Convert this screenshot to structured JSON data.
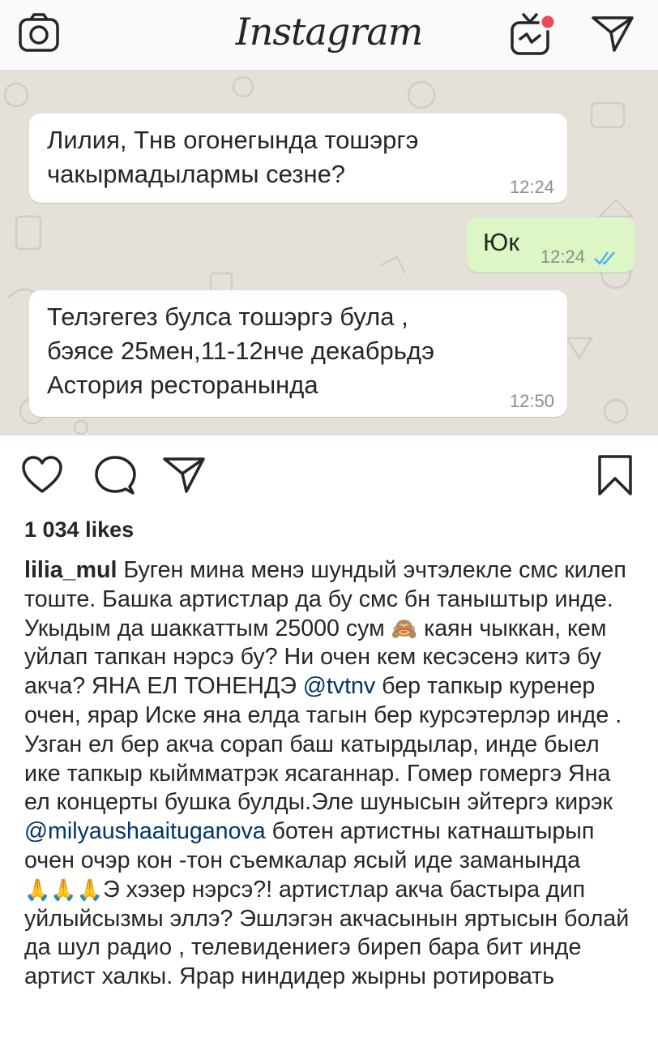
{
  "app": {
    "logo_text": "Instagram",
    "icons": [
      "camera-icon",
      "igtv-icon",
      "direct-message-icon"
    ]
  },
  "chat": {
    "messages": [
      {
        "direction": "incoming",
        "text_lines": [
          "Лилия, Тнв огонегында тошэргэ",
          "чакырмадылармы сезне?"
        ],
        "time": "12:24"
      },
      {
        "direction": "outgoing",
        "text_lines": [
          "Юк"
        ],
        "time": "12:24",
        "status": "read"
      },
      {
        "direction": "incoming",
        "text_lines": [
          "Телэгегез булса тошэргэ була ,",
          "бэясе 25мен,11-12нче декабрьдэ",
          "Астория ресторанында"
        ],
        "time": "12:50"
      }
    ]
  },
  "post": {
    "likes": "1 034 likes",
    "username": "lilia_mul",
    "caption_parts": {
      "p1": "Буген мина менэ шундый эчтэлекле смс килеп тоште. Башка артистлар да бу смс бн таныштыр инде. Укыдым да шаккаттым 25000 сум ",
      "e1": "🙈",
      "p2": " каян чыккан, кем уйлап тапкан нэрсэ бу?  Ни очен  кем кесэсенэ китэ бу акча?  ЯНА ЕЛ ТОНЕНДЭ ",
      "m1": "@tvtnv",
      "p3": " бер тапкыр куренер очен, ярар Иске яна елда тагын бер курсэтерлэр инде . Узган ел бер акча сорап баш катырдылар, инде быел ике тапкыр кыймматрэк ясаганнар. Гомер гомергэ Яна ел концерты бушка булды.Эле шунысын эйтергэ кирэк ",
      "m2": "@milyaushaaituganova",
      "p4": " ботен артистны катнаштырып очен очэр кон -тон съемкалар ясый иде заманында",
      "e2": "🙏🙏🙏",
      "p5": "Э хэзер нэрсэ?! артистлар акча бастыра дип уйлыйсызмы эллэ?  Эшлэгэн акчасынын яртысын болай да шул радио , телевидениегэ биреп бара бит инде артист халкы. Ярар ниндидер жырны ротировать"
    }
  },
  "colors": {
    "text": "#262626",
    "mention": "#003569",
    "chat_bg": "#e6e1d8",
    "incoming_bubble": "#ffffff",
    "outgoing_bubble": "#dcf7c5",
    "read_ticks": "#4fb6ec"
  }
}
